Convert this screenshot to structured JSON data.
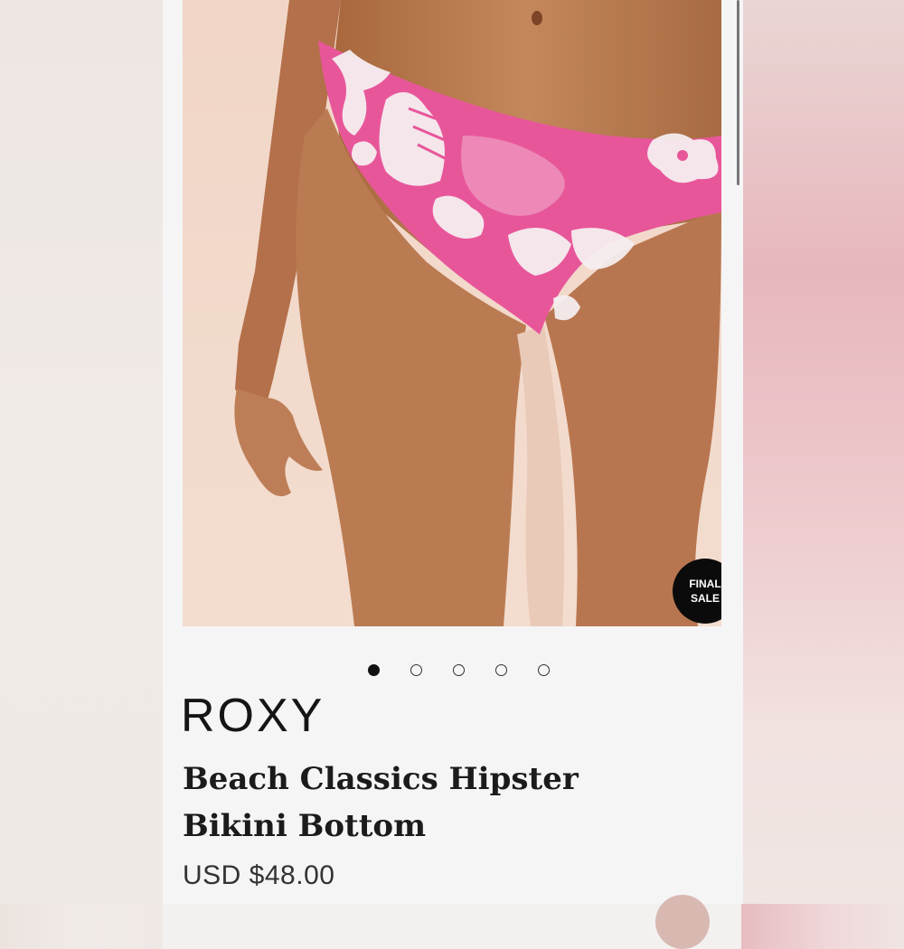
{
  "product": {
    "badge_line1": "FINAL",
    "badge_line2": "SALE",
    "brand": "ROXY",
    "title": "Beach Classics Hipster Bikini Bottom",
    "price": "USD $48.00",
    "image_count": 5,
    "active_image_index": 0,
    "image_alt": "Model wearing pink and white hibiscus print hipster bikini bottom"
  },
  "colors": {
    "swim_pink": "#e8569a",
    "print_white": "#f6eef0",
    "badge_bg": "#0b0b0b",
    "page_bg": "#f5f5f5"
  }
}
